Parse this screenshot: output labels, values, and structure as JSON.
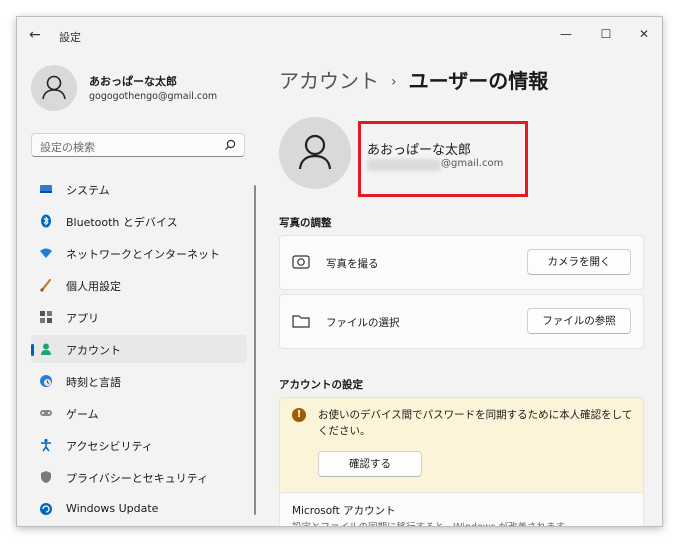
{
  "window": {
    "title": "設定",
    "back_icon": "←",
    "minimize_icon": "—",
    "maximize_icon": "☐",
    "close_icon": "✕"
  },
  "user": {
    "name": "あおっぱーな太郎",
    "email": "gogogothengo@gmail.com"
  },
  "search": {
    "placeholder": "設定の検索"
  },
  "sidebar": {
    "items": [
      {
        "label": "システム",
        "icon": "monitor-icon",
        "color": "#0067c0"
      },
      {
        "label": "Bluetooth とデバイス",
        "icon": "bluetooth-icon",
        "color": "#0067c0"
      },
      {
        "label": "ネットワークとインターネット",
        "icon": "wifi-icon",
        "color": "#0067c0"
      },
      {
        "label": "個人用設定",
        "icon": "brush-icon",
        "color": "#d08000"
      },
      {
        "label": "アプリ",
        "icon": "apps-icon",
        "color": "#4a4a4a"
      },
      {
        "label": "アカウント",
        "icon": "person-icon",
        "color": "#0f9d58",
        "active": true
      },
      {
        "label": "時刻と言語",
        "icon": "globe-clock-icon",
        "color": "#0067c0"
      },
      {
        "label": "ゲーム",
        "icon": "gamepad-icon",
        "color": "#6b6b6b"
      },
      {
        "label": "アクセシビリティ",
        "icon": "accessibility-icon",
        "color": "#0067c0"
      },
      {
        "label": "プライバシーとセキュリティ",
        "icon": "shield-icon",
        "color": "#6b6b6b"
      },
      {
        "label": "Windows Update",
        "icon": "update-icon",
        "color": "#0067c0"
      }
    ]
  },
  "breadcrumb": {
    "parent": "アカウント",
    "separator": "›",
    "current": "ユーザーの情報"
  },
  "profile": {
    "name": "あおっぱーな太郎",
    "email_visible": "@gmail.com"
  },
  "photo_section": {
    "heading": "写真の調整",
    "rows": [
      {
        "label": "写真を撮る",
        "icon": "camera-icon",
        "button": "カメラを開く"
      },
      {
        "label": "ファイルの選択",
        "icon": "folder-icon",
        "button": "ファイルの参照"
      }
    ]
  },
  "account_section": {
    "heading": "アカウントの設定",
    "warning_text": "お使いのデバイス間でパスワードを同期するために本人確認をしてください。",
    "warning_icon": "!",
    "verify_button": "確認する",
    "ms_title": "Microsoft アカウント",
    "ms_subtitle": "設定とファイルの同期に移行すると、Windows が改善されます"
  },
  "colors": {
    "accent": "#005fb8",
    "highlight_border": "#e01b24",
    "warning_bg": "#fcf4d8"
  }
}
